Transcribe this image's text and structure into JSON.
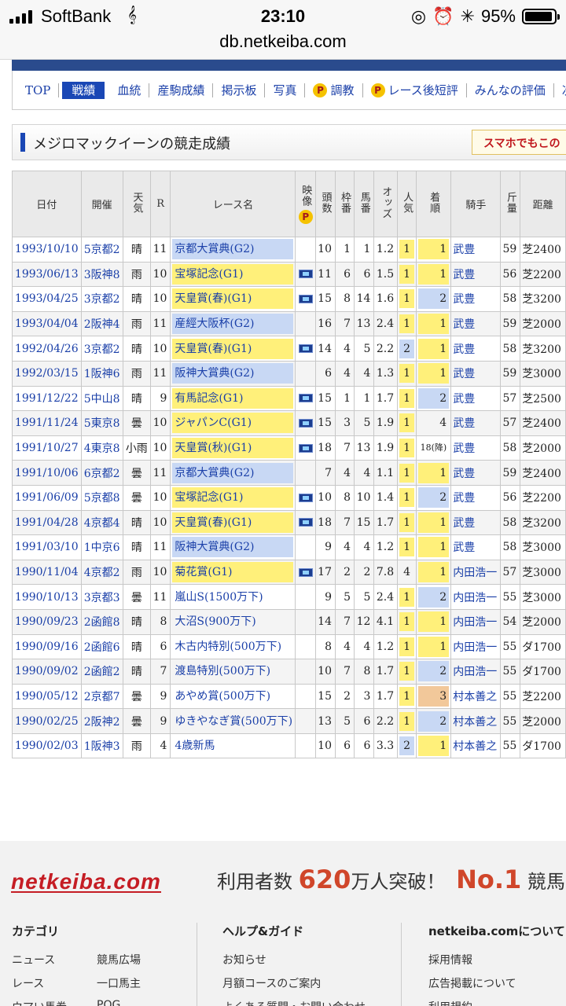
{
  "statusbar": {
    "carrier": "SoftBank",
    "time": "23:10",
    "battery": "95%",
    "battery_level": 0.95,
    "url": "db.netkeiba.com"
  },
  "nav": {
    "items": [
      {
        "label": "TOP",
        "active": false,
        "premium": false
      },
      {
        "label": "戦績",
        "active": true,
        "premium": false
      },
      {
        "label": "血統",
        "active": false,
        "premium": false
      },
      {
        "label": "産駒成績",
        "active": false,
        "premium": false
      },
      {
        "label": "掲示板",
        "active": false,
        "premium": false
      },
      {
        "label": "写真",
        "active": false,
        "premium": false
      },
      {
        "label": "調教",
        "active": false,
        "premium": true
      },
      {
        "label": "レース後短評",
        "active": false,
        "premium": true
      },
      {
        "label": "みんなの評価",
        "active": false,
        "premium": false
      },
      {
        "label": "次",
        "active": false,
        "premium": false
      }
    ],
    "premium_icon": "P"
  },
  "page": {
    "title": "メジロマックイーンの競走成績",
    "smartphone_button": "スマホでもこの"
  },
  "table": {
    "headers": {
      "date": "日付",
      "venue": "開催",
      "weather": "天気",
      "r": "R",
      "race": "レース名",
      "video": "映像",
      "heads": "頭数",
      "frame": "枠番",
      "horse_no": "馬番",
      "odds": "オッズ",
      "popularity": "人気",
      "finish": "着順",
      "jockey": "騎手",
      "weight": "斤量",
      "distance": "距離"
    },
    "rows": [
      {
        "date": "1993/10/10",
        "venue": "5京都2",
        "weather": "晴",
        "r": "11",
        "race": "京都大賞典(G2)",
        "grade": "g2",
        "video": false,
        "heads": "10",
        "frame": "1",
        "horse_no": "1",
        "odds": "1.2",
        "pop": "1",
        "finish": "1",
        "jockey": "武豊",
        "weight": "59",
        "dist": "芝2400"
      },
      {
        "date": "1993/06/13",
        "venue": "3阪神8",
        "weather": "雨",
        "r": "10",
        "race": "宝塚記念(G1)",
        "grade": "g1",
        "video": true,
        "heads": "11",
        "frame": "6",
        "horse_no": "6",
        "odds": "1.5",
        "pop": "1",
        "finish": "1",
        "jockey": "武豊",
        "weight": "56",
        "dist": "芝2200"
      },
      {
        "date": "1993/04/25",
        "venue": "3京都2",
        "weather": "晴",
        "r": "10",
        "race": "天皇賞(春)(G1)",
        "grade": "g1",
        "video": true,
        "heads": "15",
        "frame": "8",
        "horse_no": "14",
        "odds": "1.6",
        "pop": "1",
        "finish": "2",
        "jockey": "武豊",
        "weight": "58",
        "dist": "芝3200"
      },
      {
        "date": "1993/04/04",
        "venue": "2阪神4",
        "weather": "雨",
        "r": "11",
        "race": "産經大阪杯(G2)",
        "grade": "g2",
        "video": false,
        "heads": "16",
        "frame": "7",
        "horse_no": "13",
        "odds": "2.4",
        "pop": "1",
        "finish": "1",
        "jockey": "武豊",
        "weight": "59",
        "dist": "芝2000"
      },
      {
        "date": "1992/04/26",
        "venue": "3京都2",
        "weather": "晴",
        "r": "10",
        "race": "天皇賞(春)(G1)",
        "grade": "g1",
        "video": true,
        "heads": "14",
        "frame": "4",
        "horse_no": "5",
        "odds": "2.2",
        "pop": "2",
        "finish": "1",
        "jockey": "武豊",
        "weight": "58",
        "dist": "芝3200"
      },
      {
        "date": "1992/03/15",
        "venue": "1阪神6",
        "weather": "雨",
        "r": "11",
        "race": "阪神大賞典(G2)",
        "grade": "g2",
        "video": false,
        "heads": "6",
        "frame": "4",
        "horse_no": "4",
        "odds": "1.3",
        "pop": "1",
        "finish": "1",
        "jockey": "武豊",
        "weight": "59",
        "dist": "芝3000"
      },
      {
        "date": "1991/12/22",
        "venue": "5中山8",
        "weather": "晴",
        "r": "9",
        "race": "有馬記念(G1)",
        "grade": "g1",
        "video": true,
        "heads": "15",
        "frame": "1",
        "horse_no": "1",
        "odds": "1.7",
        "pop": "1",
        "finish": "2",
        "jockey": "武豊",
        "weight": "57",
        "dist": "芝2500"
      },
      {
        "date": "1991/11/24",
        "venue": "5東京8",
        "weather": "曇",
        "r": "10",
        "race": "ジャパンC(G1)",
        "grade": "g1",
        "video": true,
        "heads": "15",
        "frame": "3",
        "horse_no": "5",
        "odds": "1.9",
        "pop": "1",
        "finish": "4",
        "jockey": "武豊",
        "weight": "57",
        "dist": "芝2400"
      },
      {
        "date": "1991/10/27",
        "venue": "4東京8",
        "weather": "小雨",
        "r": "10",
        "race": "天皇賞(秋)(G1)",
        "grade": "g1",
        "video": true,
        "heads": "18",
        "frame": "7",
        "horse_no": "13",
        "odds": "1.9",
        "pop": "1",
        "finish": "18(降)",
        "jockey": "武豊",
        "weight": "58",
        "dist": "芝2000"
      },
      {
        "date": "1991/10/06",
        "venue": "6京都2",
        "weather": "曇",
        "r": "11",
        "race": "京都大賞典(G2)",
        "grade": "g2",
        "video": false,
        "heads": "7",
        "frame": "4",
        "horse_no": "4",
        "odds": "1.1",
        "pop": "1",
        "finish": "1",
        "jockey": "武豊",
        "weight": "59",
        "dist": "芝2400"
      },
      {
        "date": "1991/06/09",
        "venue": "5京都8",
        "weather": "曇",
        "r": "10",
        "race": "宝塚記念(G1)",
        "grade": "g1",
        "video": true,
        "heads": "10",
        "frame": "8",
        "horse_no": "10",
        "odds": "1.4",
        "pop": "1",
        "finish": "2",
        "jockey": "武豊",
        "weight": "56",
        "dist": "芝2200"
      },
      {
        "date": "1991/04/28",
        "venue": "4京都4",
        "weather": "晴",
        "r": "10",
        "race": "天皇賞(春)(G1)",
        "grade": "g1",
        "video": true,
        "heads": "18",
        "frame": "7",
        "horse_no": "15",
        "odds": "1.7",
        "pop": "1",
        "finish": "1",
        "jockey": "武豊",
        "weight": "58",
        "dist": "芝3200"
      },
      {
        "date": "1991/03/10",
        "venue": "1中京6",
        "weather": "晴",
        "r": "11",
        "race": "阪神大賞典(G2)",
        "grade": "g2",
        "video": false,
        "heads": "9",
        "frame": "4",
        "horse_no": "4",
        "odds": "1.2",
        "pop": "1",
        "finish": "1",
        "jockey": "武豊",
        "weight": "58",
        "dist": "芝3000"
      },
      {
        "date": "1990/11/04",
        "venue": "4京都2",
        "weather": "雨",
        "r": "10",
        "race": "菊花賞(G1)",
        "grade": "g1",
        "video": true,
        "heads": "17",
        "frame": "2",
        "horse_no": "2",
        "odds": "7.8",
        "pop": "4",
        "finish": "1",
        "jockey": "内田浩一",
        "weight": "57",
        "dist": "芝3000"
      },
      {
        "date": "1990/10/13",
        "venue": "3京都3",
        "weather": "曇",
        "r": "11",
        "race": "嵐山S(1500万下)",
        "grade": "",
        "video": false,
        "heads": "9",
        "frame": "5",
        "horse_no": "5",
        "odds": "2.4",
        "pop": "1",
        "finish": "2",
        "jockey": "内田浩一",
        "weight": "55",
        "dist": "芝3000"
      },
      {
        "date": "1990/09/23",
        "venue": "2函館8",
        "weather": "晴",
        "r": "8",
        "race": "大沼S(900万下)",
        "grade": "",
        "video": false,
        "heads": "14",
        "frame": "7",
        "horse_no": "12",
        "odds": "4.1",
        "pop": "1",
        "finish": "1",
        "jockey": "内田浩一",
        "weight": "54",
        "dist": "芝2000"
      },
      {
        "date": "1990/09/16",
        "venue": "2函館6",
        "weather": "晴",
        "r": "6",
        "race": "木古内特別(500万下)",
        "grade": "",
        "video": false,
        "heads": "8",
        "frame": "4",
        "horse_no": "4",
        "odds": "1.2",
        "pop": "1",
        "finish": "1",
        "jockey": "内田浩一",
        "weight": "55",
        "dist": "ダ1700"
      },
      {
        "date": "1990/09/02",
        "venue": "2函館2",
        "weather": "晴",
        "r": "7",
        "race": "渡島特別(500万下)",
        "grade": "",
        "video": false,
        "heads": "10",
        "frame": "7",
        "horse_no": "8",
        "odds": "1.7",
        "pop": "1",
        "finish": "2",
        "jockey": "内田浩一",
        "weight": "55",
        "dist": "ダ1700"
      },
      {
        "date": "1990/05/12",
        "venue": "2京都7",
        "weather": "曇",
        "r": "9",
        "race": "あやめ賞(500万下)",
        "grade": "",
        "video": false,
        "heads": "15",
        "frame": "2",
        "horse_no": "3",
        "odds": "1.7",
        "pop": "1",
        "finish": "3",
        "jockey": "村本善之",
        "weight": "55",
        "dist": "芝2200"
      },
      {
        "date": "1990/02/25",
        "venue": "2阪神2",
        "weather": "曇",
        "r": "9",
        "race": "ゆきやなぎ賞(500万下)",
        "grade": "",
        "video": false,
        "heads": "13",
        "frame": "5",
        "horse_no": "6",
        "odds": "2.2",
        "pop": "1",
        "finish": "2",
        "jockey": "村本善之",
        "weight": "55",
        "dist": "芝2000"
      },
      {
        "date": "1990/02/03",
        "venue": "1阪神3",
        "weather": "雨",
        "r": "4",
        "race": "4歳新馬",
        "grade": "",
        "video": false,
        "heads": "10",
        "frame": "6",
        "horse_no": "6",
        "odds": "3.3",
        "pop": "2",
        "finish": "1",
        "jockey": "村本善之",
        "weight": "55",
        "dist": "ダ1700"
      }
    ]
  },
  "footer": {
    "logo": "netkeiba.com",
    "users_prefix": "利用者数",
    "users_count": "620",
    "users_suffix": "万人突破！",
    "no1": "No.1",
    "no1_suffix": "競馬",
    "categories_title": "カテゴリ",
    "categories": [
      "ニュース",
      "競馬広場",
      "レース",
      "一口馬主",
      "ウマい馬券",
      "POG"
    ],
    "help_title": "ヘルプ&ガイド",
    "help": [
      "お知らせ",
      "月額コースのご案内",
      "よくある質問・お問い合わせ"
    ],
    "about_title": "netkeiba.comについて",
    "about": [
      "採用情報",
      "広告掲載について",
      "利用規約"
    ]
  },
  "colors": {
    "nav_blue": "#2a4b8d",
    "active_tab": "#1a47b5",
    "link": "#1a3fa8",
    "g1_highlight": "#fff07a",
    "g2_highlight": "#c8d8f4",
    "third_place": "#f2c89a",
    "brand_red": "#c51d24"
  }
}
